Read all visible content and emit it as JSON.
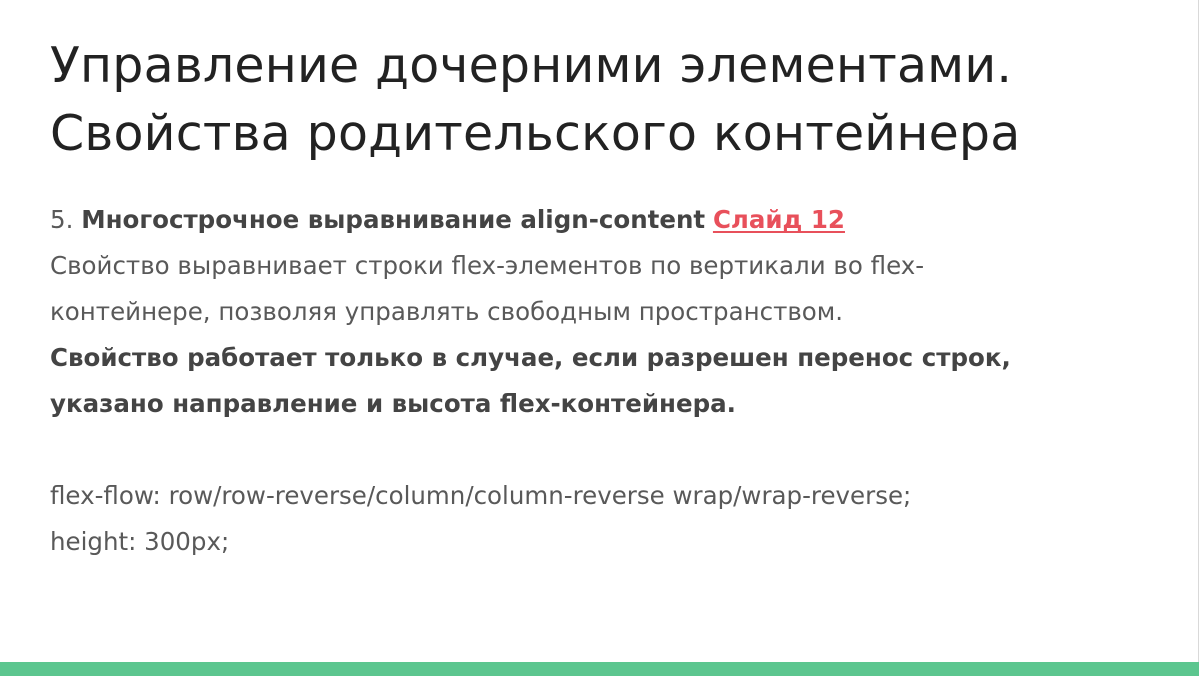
{
  "title": {
    "line1": "Управление дочерними элементами.",
    "line2": "Свойства родительского контейнера"
  },
  "item": {
    "number": "5.",
    "heading": "Многострочное выравнивание align-content",
    "link_label": "Слайд 12"
  },
  "description": {
    "line1": "Свойство выравнивает строки flex-элементов по вертикали во flex-",
    "line2": "контейнере, позволяя управлять свободным пространством."
  },
  "note": {
    "line1": "Свойство работает только в случае, если разрешен перенос строк,",
    "line2": "указано направление и высота flex-контейнера."
  },
  "code": {
    "line1": "flex-flow: row/row-reverse/column/column-reverse wrap/wrap-reverse;",
    "line2": "height: 300px;"
  },
  "colors": {
    "accent_bar": "#5cc68f",
    "link": "#e8505b",
    "title_text": "#222222",
    "body_text": "#595959"
  }
}
